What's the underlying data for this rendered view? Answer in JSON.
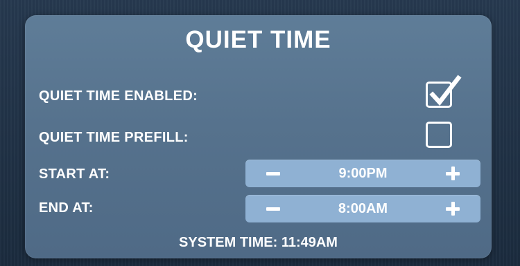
{
  "screen": {
    "title": "QUIET TIME",
    "system_time": "SYSTEM TIME: 11:49AM"
  },
  "settings": {
    "enabled": {
      "label": "QUIET TIME ENABLED:",
      "checked": true
    },
    "prefill": {
      "label": "QUIET TIME PREFILL:",
      "checked": false
    },
    "start": {
      "label": "START AT:",
      "value": "9:00PM"
    },
    "end": {
      "label": "END AT:",
      "value": "8:00AM"
    }
  },
  "icons": {
    "check": "checkmark-icon",
    "decrement": "minus-icon",
    "increment": "plus-icon"
  },
  "colors": {
    "panel": "#56728d",
    "stepper": "#8fb1d3",
    "text": "#ffffff"
  }
}
